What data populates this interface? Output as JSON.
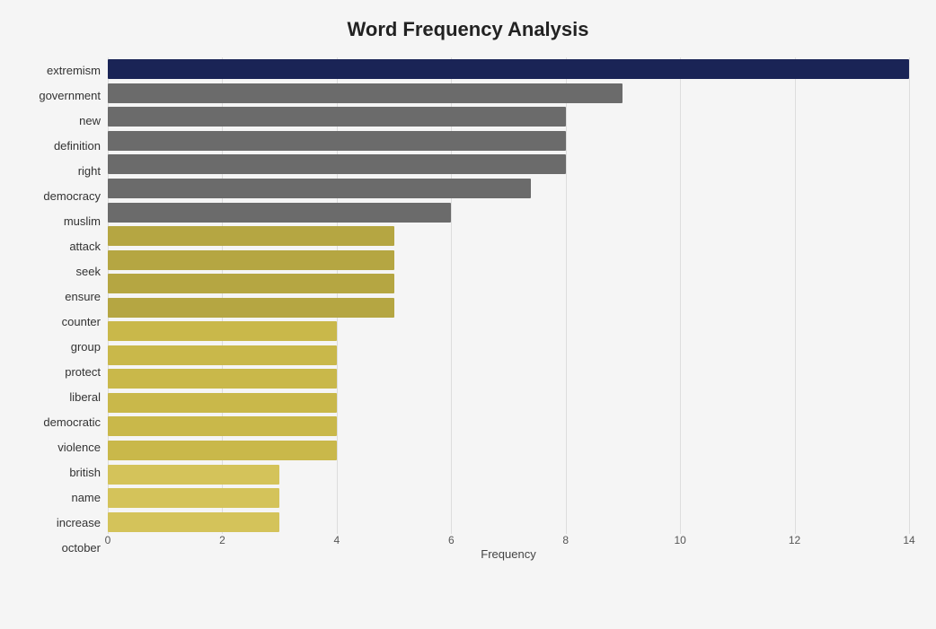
{
  "title": "Word Frequency Analysis",
  "xAxisLabel": "Frequency",
  "maxFrequency": 14,
  "xTicks": [
    0,
    2,
    4,
    6,
    8,
    10,
    12,
    14
  ],
  "bars": [
    {
      "label": "extremism",
      "value": 14,
      "color": "#1a2456"
    },
    {
      "label": "government",
      "value": 9,
      "color": "#6b6b6b"
    },
    {
      "label": "new",
      "value": 8,
      "color": "#6b6b6b"
    },
    {
      "label": "definition",
      "value": 8,
      "color": "#6b6b6b"
    },
    {
      "label": "right",
      "value": 8,
      "color": "#6b6b6b"
    },
    {
      "label": "democracy",
      "value": 7.4,
      "color": "#6b6b6b"
    },
    {
      "label": "muslim",
      "value": 6,
      "color": "#6b6b6b"
    },
    {
      "label": "attack",
      "value": 5,
      "color": "#b5a642"
    },
    {
      "label": "seek",
      "value": 5,
      "color": "#b5a642"
    },
    {
      "label": "ensure",
      "value": 5,
      "color": "#b5a642"
    },
    {
      "label": "counter",
      "value": 5,
      "color": "#b5a642"
    },
    {
      "label": "group",
      "value": 4,
      "color": "#c9b84a"
    },
    {
      "label": "protect",
      "value": 4,
      "color": "#c9b84a"
    },
    {
      "label": "liberal",
      "value": 4,
      "color": "#c9b84a"
    },
    {
      "label": "democratic",
      "value": 4,
      "color": "#c9b84a"
    },
    {
      "label": "violence",
      "value": 4,
      "color": "#c9b84a"
    },
    {
      "label": "british",
      "value": 4,
      "color": "#c9b84a"
    },
    {
      "label": "name",
      "value": 3,
      "color": "#d4c35a"
    },
    {
      "label": "increase",
      "value": 3,
      "color": "#d4c35a"
    },
    {
      "label": "october",
      "value": 3,
      "color": "#d4c35a"
    }
  ]
}
